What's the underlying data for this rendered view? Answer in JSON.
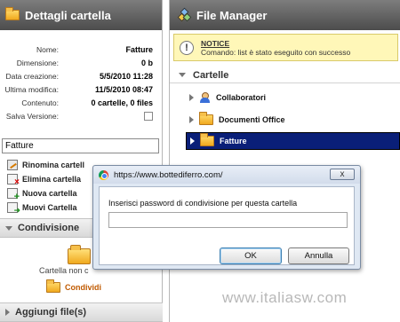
{
  "left_panel": {
    "title": "Dettagli cartella",
    "details": [
      {
        "label": "Nome:",
        "value": "Fatture"
      },
      {
        "label": "Dimensione:",
        "value": "0 b"
      },
      {
        "label": "Data creazione:",
        "value": "5/5/2010 11:28"
      },
      {
        "label": "Ultima modifica:",
        "value": "11/5/2010 08:47"
      },
      {
        "label": "Contenuto:",
        "value": "0 cartelle, 0 files"
      },
      {
        "label": "Salva Versione:",
        "value": ""
      }
    ],
    "name_input_value": "Fatture",
    "actions": [
      {
        "label": "Rinomina cartell",
        "icon": "rename-icon"
      },
      {
        "label": "Elimina cartella",
        "icon": "delete-icon"
      },
      {
        "label": "Nuova cartella",
        "icon": "new-folder-icon"
      },
      {
        "label": "Muovi Cartella",
        "icon": "move-icon"
      }
    ],
    "share_section": {
      "title": "Condivisione",
      "text": "Cartella non c",
      "button_label": "Condividi"
    },
    "add_files_section": {
      "title": "Aggiungi file(s)"
    }
  },
  "right_panel": {
    "title": "File Manager",
    "notice": {
      "title": "NOTICE",
      "message": "Comando: list è stato eseguito con successo"
    },
    "folders_title": "Cartelle",
    "tree": [
      {
        "label": "Collaboratori",
        "icon": "users-icon",
        "selected": false
      },
      {
        "label": "Documenti Office",
        "icon": "folder-icon",
        "selected": false
      },
      {
        "label": "Fatture",
        "icon": "folder-icon",
        "selected": true
      }
    ]
  },
  "dialog": {
    "title": "https://www.bottediferro.com/",
    "close_label": "x",
    "prompt": "Inserisci password di condivisione per questa cartella",
    "input_value": "",
    "ok_label": "OK",
    "cancel_label": "Annulla"
  },
  "watermark": "www.italiasw.com",
  "colors": {
    "header_bg": "#5c5c5c",
    "selected_row": "#0a1f78",
    "notice_bg": "#fff7b8",
    "action_accent": "#c05a00"
  }
}
